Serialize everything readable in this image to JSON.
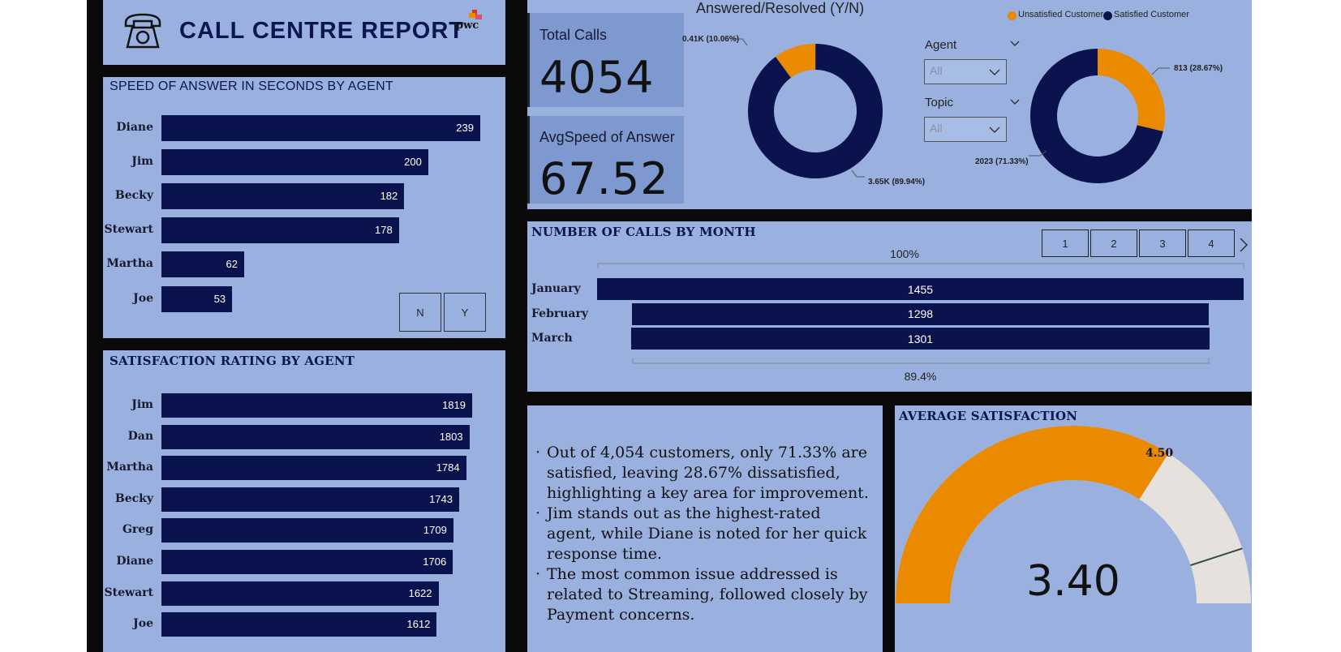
{
  "header": {
    "title": "CALL CENTRE REPORT",
    "logo_text": "pwc"
  },
  "speed_chart": {
    "title": "SPEED OF ANSWER IN SECONDS BY AGENT",
    "slicer": [
      "N",
      "Y"
    ]
  },
  "satisfaction_chart": {
    "title": "SATISFACTION RATING BY AGENT"
  },
  "kpis": {
    "total_calls_label": "Total Calls",
    "total_calls_value": "4054",
    "avg_speed_label": "AvgSpeed of Answer",
    "avg_speed_value": "67.52"
  },
  "answered_chart": {
    "title": "Answered/Resolved (Y/N)",
    "label_small": "0.41K (10.06%)",
    "label_large": "3.65K (89.94%)"
  },
  "filters": {
    "agent_label": "Agent",
    "agent_value": "All",
    "topic_label": "Topic",
    "topic_value": "All"
  },
  "customer_chart": {
    "legend_unsatisfied": "Unsatisfied Customer",
    "legend_satisfied": "Satisfied Customer",
    "label_unsatisfied": "813 (28.67%)",
    "label_satisfied": "2023 (71.33%)"
  },
  "monthly_chart": {
    "title": "NUMBER OF CALLS BY MONTH",
    "top_pct": "100%",
    "bottom_pct": "89.4%",
    "pages": [
      "1",
      "2",
      "3",
      "4"
    ],
    "next_icon": "›"
  },
  "insights": [
    "Out of 4,054 customers, only 71.33% are satisfied, leaving 28.67% dissatisfied, highlighting a key area for improvement.",
    "Jim stands out as the highest-rated agent, while Diane is noted for her quick response time.",
    "The most common issue addressed is related to Streaming, followed closely by Payment concerns."
  ],
  "gauge": {
    "title": "AVERAGE SATISFACTION",
    "value_text": "3.40",
    "target_text": "4.50"
  },
  "colors": {
    "navy": "#0b134f",
    "orange": "#ea8a00",
    "panel": "#9ab0df",
    "gauge_bg": "#e6e1dc"
  },
  "chart_data": [
    {
      "type": "bar",
      "title": "SPEED OF ANSWER IN SECONDS BY AGENT",
      "categories": [
        "Diane",
        "Jim",
        "Becky",
        "Stewart",
        "Martha",
        "Joe"
      ],
      "values": [
        239,
        200,
        182,
        178,
        62,
        53
      ]
    },
    {
      "type": "bar",
      "title": "SATISFACTION RATING BY AGENT",
      "categories": [
        "Jim",
        "Dan",
        "Martha",
        "Becky",
        "Greg",
        "Diane",
        "Stewart",
        "Joe"
      ],
      "values": [
        1819,
        1803,
        1784,
        1743,
        1709,
        1706,
        1622,
        1612
      ]
    },
    {
      "type": "pie",
      "title": "Answered/Resolved (Y/N)",
      "categories": [
        "N",
        "Y"
      ],
      "values": [
        410,
        3650
      ],
      "percent": [
        10.06,
        89.94
      ]
    },
    {
      "type": "pie",
      "categories": [
        "Unsatisfied Customer",
        "Satisfied Customer"
      ],
      "values": [
        813,
        2023
      ],
      "percent": [
        28.67,
        71.33
      ]
    },
    {
      "type": "bar",
      "title": "NUMBER OF CALLS BY MONTH",
      "categories": [
        "January",
        "February",
        "March"
      ],
      "values": [
        1455,
        1298,
        1301
      ]
    },
    {
      "type": "gauge",
      "title": "AVERAGE SATISFACTION",
      "value": 3.4,
      "target": 4.5,
      "min": 0,
      "max": 5
    }
  ]
}
